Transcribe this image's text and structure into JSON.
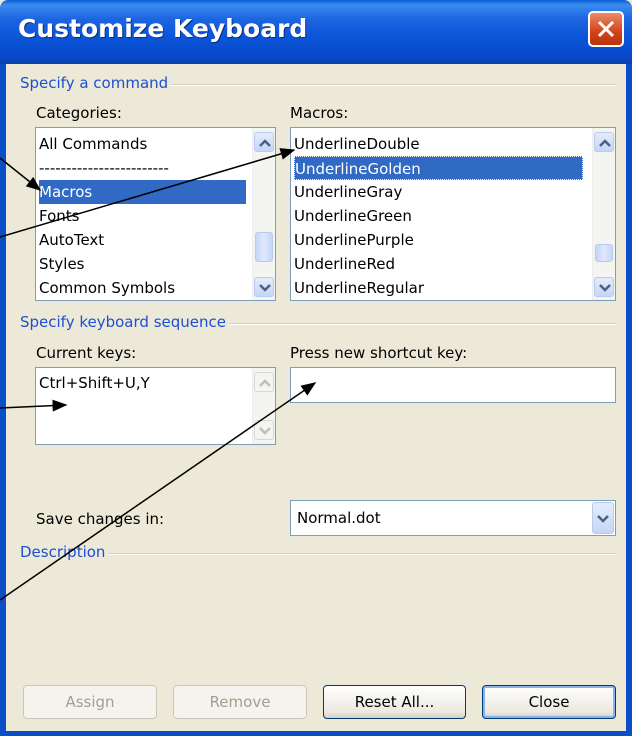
{
  "window": {
    "title": "Customize Keyboard"
  },
  "icons": {
    "close": "close-x-icon",
    "up": "chevron-up-icon",
    "down": "chevron-down-icon"
  },
  "colors": {
    "title_bar": "#0a54d8",
    "group_title": "#1d4fd0",
    "selection": "#316ac5",
    "close_button": "#d24318"
  },
  "command_group": {
    "title": "Specify a command",
    "categories": {
      "label": "Categories:",
      "items": [
        "All Commands",
        "------------------------",
        "Macros",
        "Fonts",
        "AutoText",
        "Styles",
        "Common Symbols"
      ],
      "selected": "Macros"
    },
    "macros": {
      "label": "Macros:",
      "items": [
        "UnderlineDouble",
        "UnderlineGolden",
        "UnderlineGray",
        "UnderlineGreen",
        "UnderlinePurple",
        "UnderlineRed",
        "UnderlineRegular"
      ],
      "selected": "UnderlineGolden"
    }
  },
  "keyboard_group": {
    "title": "Specify keyboard sequence",
    "current_keys": {
      "label": "Current keys:",
      "items": [
        "Ctrl+Shift+U,Y"
      ]
    },
    "new_shortcut": {
      "label": "Press new shortcut key:",
      "value": ""
    }
  },
  "save_changes": {
    "label": "Save changes in:",
    "value": "Normal.dot"
  },
  "description": {
    "title": "Description"
  },
  "buttons": {
    "assign": "Assign",
    "remove": "Remove",
    "reset_all": "Reset All...",
    "close": "Close"
  }
}
